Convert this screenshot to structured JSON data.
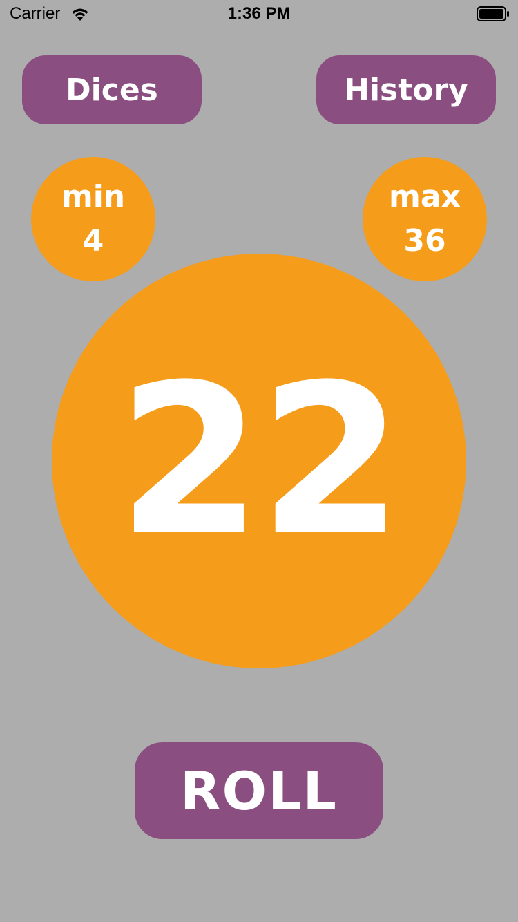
{
  "status_bar": {
    "carrier": "Carrier",
    "time": "1:36 PM",
    "icons": [
      "wifi-icon",
      "battery-icon"
    ]
  },
  "header": {
    "dices_label": "Dices",
    "history_label": "History"
  },
  "stats": {
    "min_label": "min",
    "min_value": "4",
    "max_label": "max",
    "max_value": "36"
  },
  "result": {
    "value": "22"
  },
  "actions": {
    "roll_label": "ROLL"
  },
  "colors": {
    "background": "#adadad",
    "button": "#8a4f80",
    "accent": "#f59c1a",
    "text": "#ffffff"
  }
}
